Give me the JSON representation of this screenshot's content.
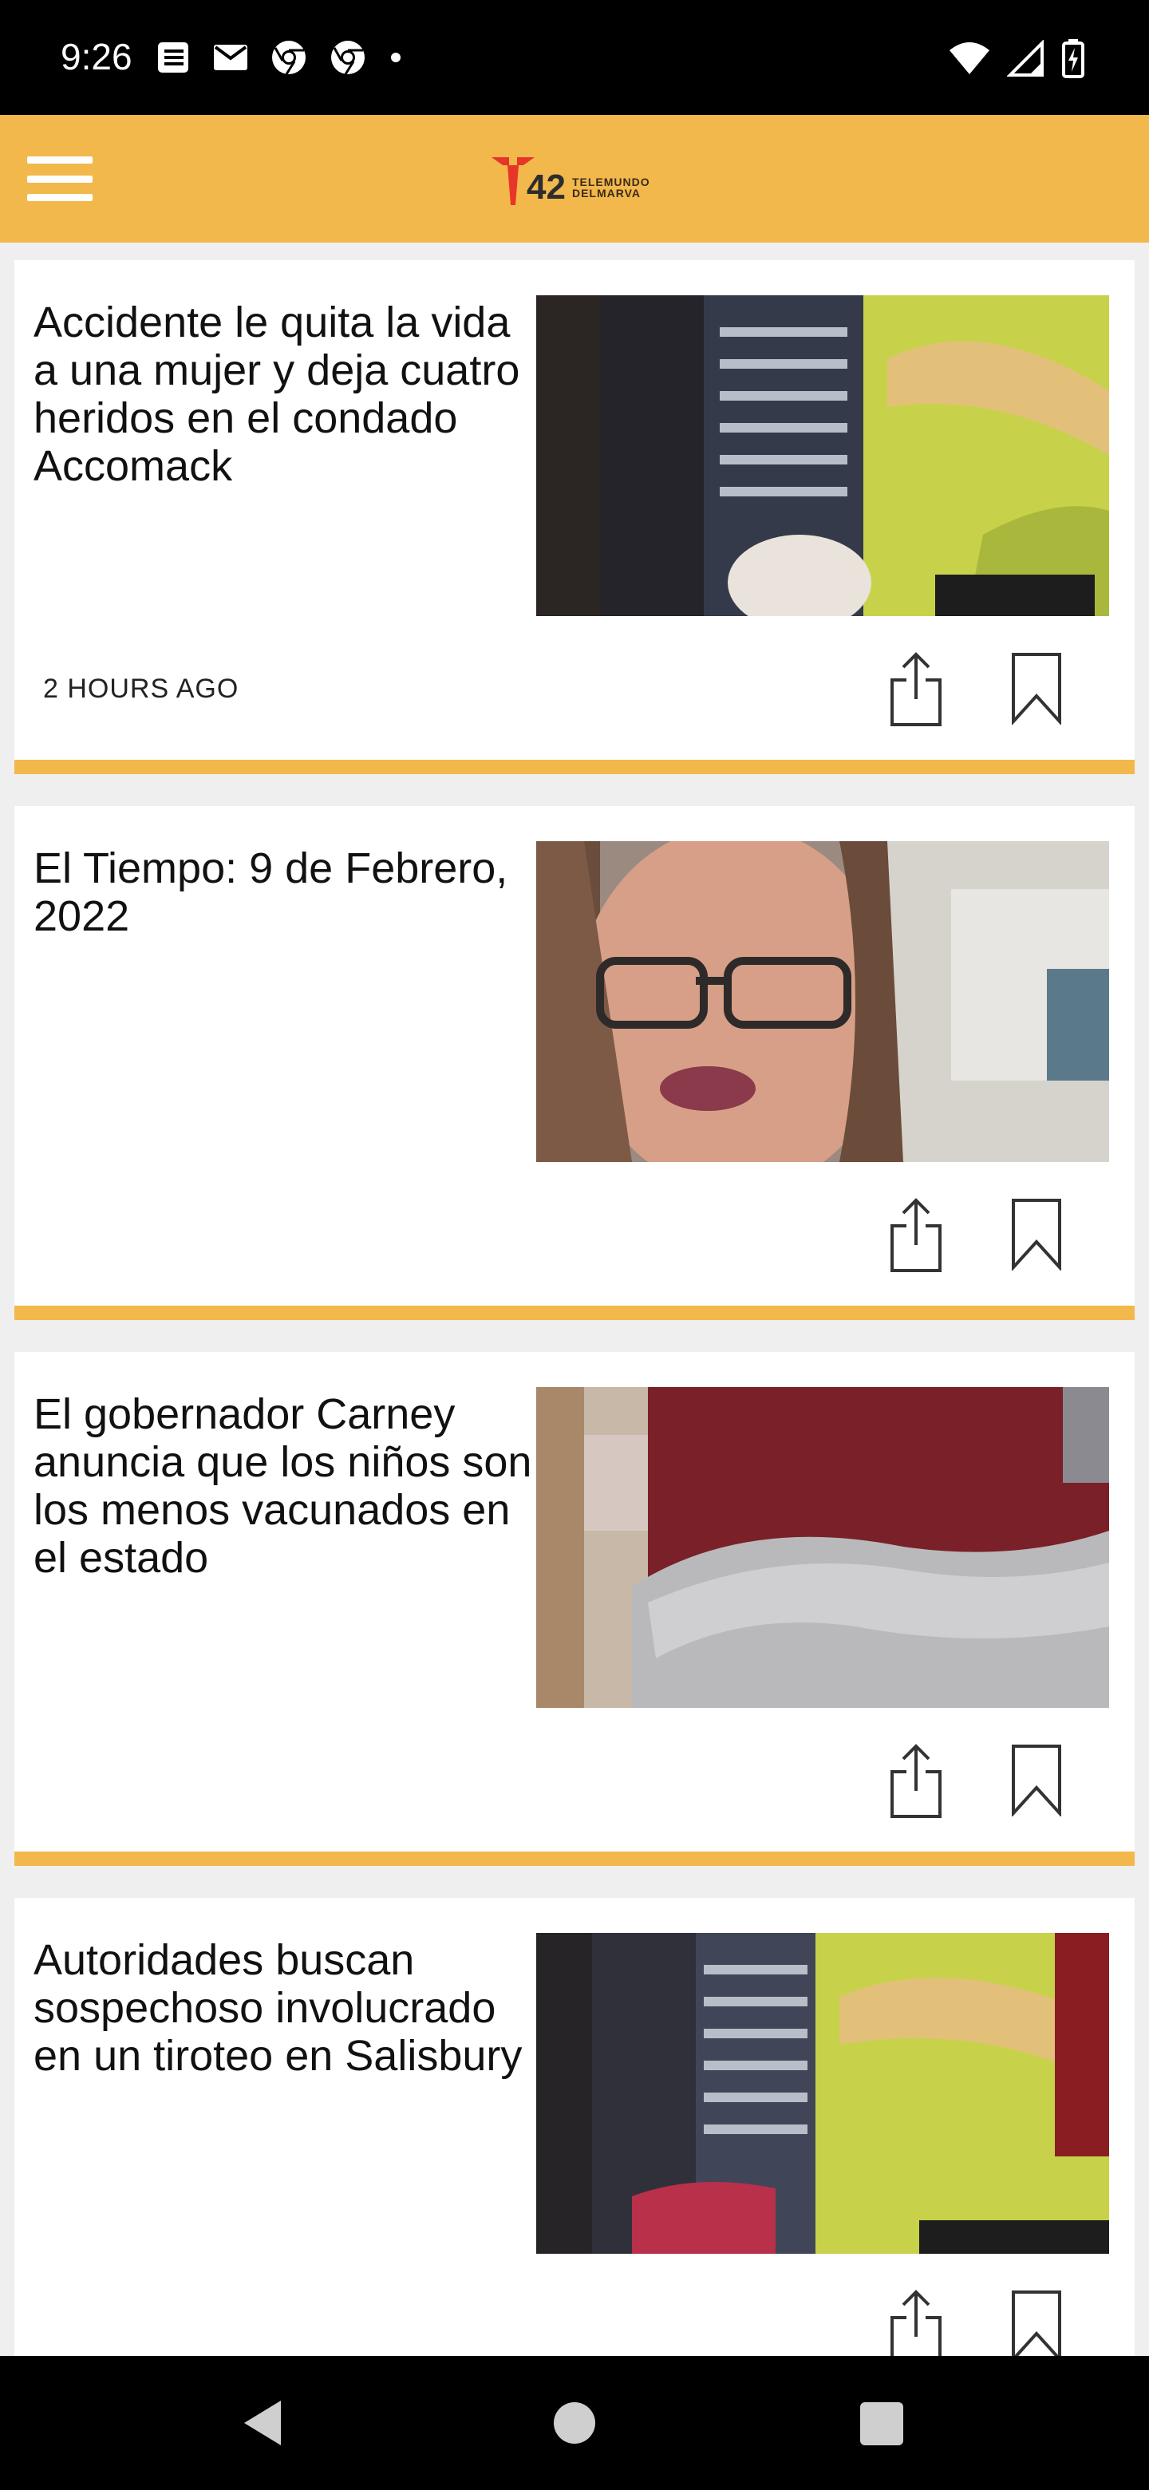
{
  "status_bar": {
    "time": "9:26",
    "left_icons": [
      "news-icon",
      "mail-icon",
      "chrome-icon",
      "chrome-icon",
      "dot-icon"
    ],
    "right_icons": [
      "wifi-icon",
      "signal-icon",
      "battery-charging-icon"
    ]
  },
  "app_bar": {
    "logo_number": "42",
    "logo_line1": "TELEMUNDO",
    "logo_line2": "DELMARVA",
    "brand_color": "#f2b84b"
  },
  "articles": [
    {
      "title": "Accidente le quita la vida a una mujer y deja cuatro heridos en el condado Accomack",
      "time": "2 HOURS AGO"
    },
    {
      "title": "El Tiempo: 9 de Febrero, 2022",
      "time": ""
    },
    {
      "title": "El gobernador Carney anuncia que los niños son los menos vacunados en el estado",
      "time": ""
    },
    {
      "title": "Autoridades buscan sospechoso involucrado en un tiroteo en Salisbury",
      "time": ""
    }
  ],
  "nav_bar": {
    "buttons": [
      "back-icon",
      "home-icon",
      "recents-icon"
    ]
  }
}
